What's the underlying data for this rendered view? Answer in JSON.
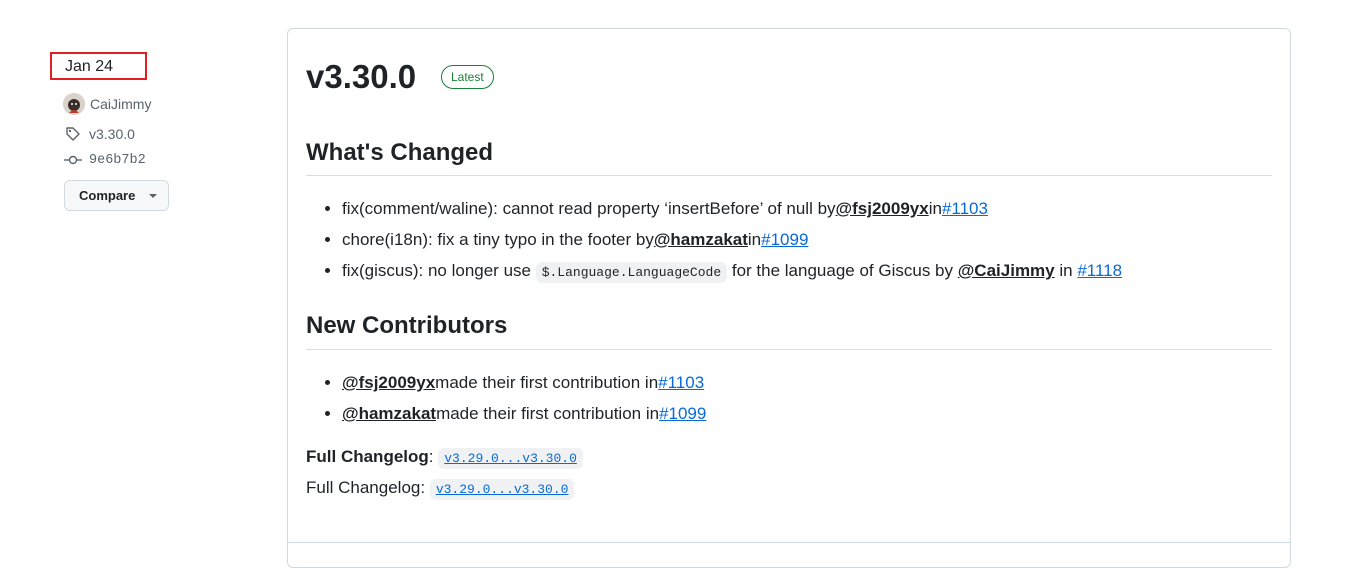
{
  "sidebar": {
    "date": "Jan 24",
    "author": "CaiJimmy",
    "tag": "v3.30.0",
    "commit": "9e6b7b2",
    "compare_label": "Compare"
  },
  "release": {
    "title": "v3.30.0",
    "badge": "Latest",
    "whats_changed_heading": "What's Changed",
    "changes": [
      {
        "text": "fix(comment/waline): cannot read property ‘insertBefore’ of null by",
        "user": "@fsj2009yx",
        "in": "in",
        "pr": "#1103"
      },
      {
        "text": "chore(i18n): fix a tiny typo in the footer by",
        "user": "@hamzakat",
        "in": "in",
        "pr": "#1099"
      },
      {
        "text_before": "fix(giscus): no longer use ",
        "code": "$.Language.LanguageCode",
        "text_after": " for the language of Giscus by ",
        "user": "@CaiJimmy",
        "in": " in ",
        "pr": "#1118"
      }
    ],
    "new_contributors_heading": "New Contributors",
    "contributors": [
      {
        "user": "@fsj2009yx",
        "text": "made their first contribution in",
        "pr": "#1103"
      },
      {
        "user": "@hamzakat",
        "text": "made their first contribution in",
        "pr": "#1099"
      }
    ],
    "full_changelog_label": "Full Changelog",
    "full_changelog_sep": ":",
    "full_changelog_link": "v3.29.0...v3.30.0",
    "full_changelog_label_2": "Full Changelog:",
    "full_changelog_link_2": "v3.29.0...v3.30.0"
  },
  "colors": {
    "accent_link": "#0969da",
    "badge_green": "#1a7f37",
    "highlight_box": "#e02020"
  }
}
